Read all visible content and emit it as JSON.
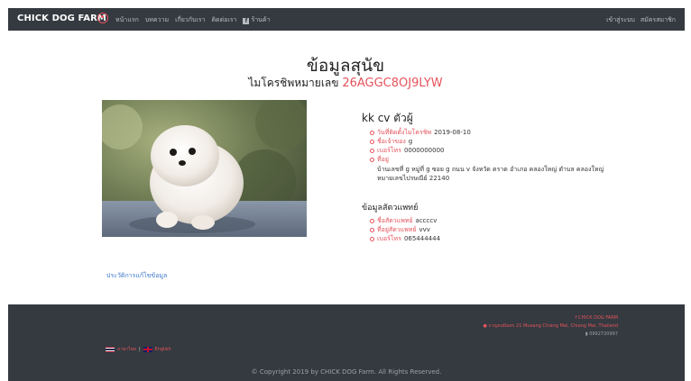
{
  "navbar": {
    "brand": "CHICK DOG FARM",
    "links": [
      "หน้าแรก",
      "บทความ",
      "เกี่ยวกับเรา",
      "ติดต่อเรา"
    ],
    "shop_label": "ร้านค้า",
    "login": "เข้าสู่ระบบ",
    "register": "สมัครสมาชิก"
  },
  "page": {
    "title": "ข้อมูลสุนัข",
    "subtitle_prefix": "ไมโครชิพหมายเลข",
    "chip_number": "26AGGC8OJ9LYW"
  },
  "dog": {
    "name": "kk cv ตัวผู้",
    "fields": [
      {
        "label": "วันที่ติดตั้งไมโครชิพ",
        "value": "2019-08-10"
      },
      {
        "label": "ชื่อเจ้าของ",
        "value": "g"
      },
      {
        "label": "เบอร์โทร",
        "value": "0000000000"
      },
      {
        "label": "ที่อยู่",
        "value": "บ้านเลขที่ g หมู่ที่ g ซอย g ถนน v จังหวัด ตราด อำเภอ คลองใหญ่ ตำบล คลองใหญ่ หมายเลขไปรษณีย์ 22140"
      }
    ]
  },
  "vet": {
    "heading": "ข้อมูลสัตวแพทย์",
    "fields": [
      {
        "label": "ชื่อสัตวแพทย์",
        "value": "accccv"
      },
      {
        "label": "ที่อยู่สัตวแพทย์",
        "value": "vvv"
      },
      {
        "label": "เบอร์โทร",
        "value": "065444444"
      }
    ]
  },
  "history_link": "ประวัติการแก้ไขข้อมูล",
  "footer": {
    "company": "CHICK DOG FARM",
    "address": "กาญจนบินทร 21 Mueang Chiang Mai, Chiang Mai, Thailand",
    "phone": "0992720997",
    "lang_th": "ภาษาไทย",
    "lang_en": "English",
    "copyright": "© Copyright 2019 by CHICK DOG Farm. All Rights Reserved."
  },
  "colors": {
    "accent": "#e5535c",
    "navbar": "#343a40",
    "link": "#3c78c8"
  }
}
